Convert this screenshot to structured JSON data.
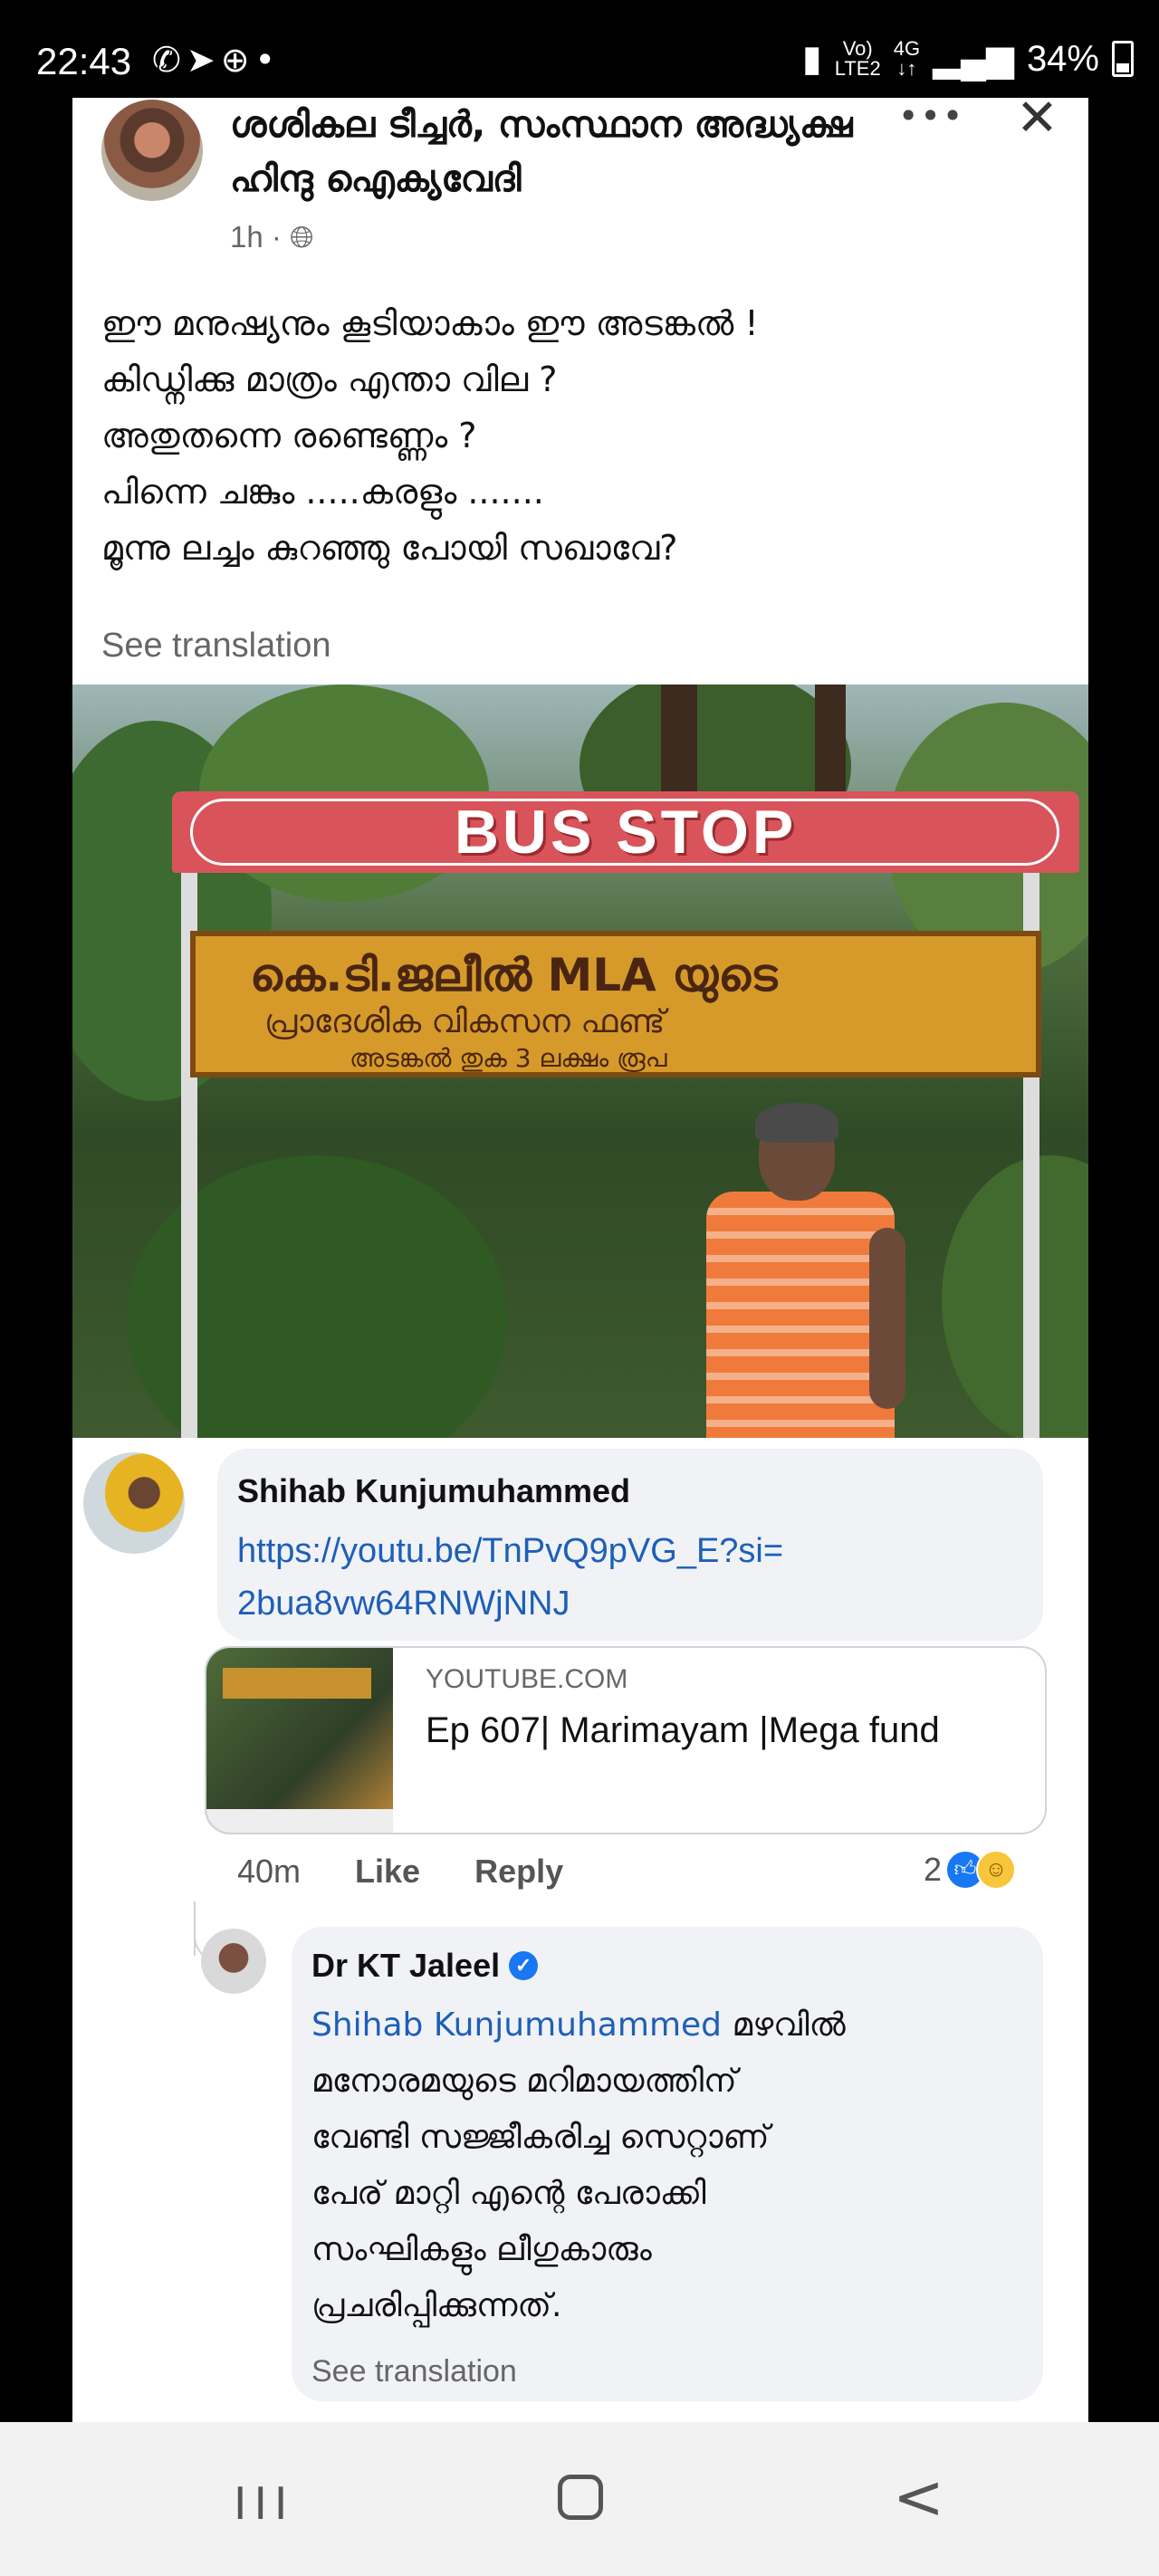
{
  "status_bar": {
    "time": "22:43",
    "left_icons": [
      "whatsapp-icon",
      "send-icon",
      "game-icon",
      "dot-icon"
    ],
    "carrier_line1": "Vo)",
    "carrier_line2": "LTE2",
    "net_line1": "4G",
    "net_line2": "↓↑",
    "battery": "34%"
  },
  "post": {
    "author": "ശശികല ടീച്ചർ, സംസ്ഥാന അദ്ധ്യക്ഷ ഹിന്ദു ഐക്യവേദി",
    "time": "1h",
    "audience_icon": "globe-icon",
    "text_lines": [
      "ഈ മനുഷ്യനും കൂടിയാകാം ഈ  അടങ്കൽ !",
      "കിഡ്നിക്കു മാത്രം എന്താ വില ?",
      "അതുതന്നെ രണ്ടെണ്ണം ?",
      "പിന്നെ ചങ്കും .....കരളും .......",
      "മൂന്നു ലച്ചം കുറഞ്ഞു പോയി സഖാവേ?"
    ],
    "see_translation": "See translation",
    "image": {
      "roof_sign": "BUS STOP",
      "board_line1": "കെ.ടി.ജലീൽ MLA യുടെ",
      "board_line2": "പ്രാദേശിക വികസന ഫണ്ട്",
      "board_line3": "അടങ്കൽ തുക 3 ലക്ഷം രൂപ"
    }
  },
  "comment": {
    "name": "Shihab Kunjumuhammed",
    "link_line1": "https://youtu.be/TnPvQ9pVG_E?si=",
    "link_line2": "2bua8vw64RNWjNNJ",
    "card_source": "YOUTUBE.COM",
    "card_title": "Ep 607| Marimayam |Mega fund",
    "age": "40m",
    "like_label": "Like",
    "reply_label": "Reply",
    "reaction_count": "2"
  },
  "reply": {
    "name": "Dr KT Jaleel",
    "mention": "Shihab Kunjumuhammed",
    "line1_rest": " മഴവിൽ",
    "text_lines": [
      "മനോരമയുടെ മറിമായത്തിന്",
      "വേണ്ടി സജ്ജീകരിച്ച സെറ്റാണ്",
      "പേര് മാറ്റി എന്റെ പേരാക്കി",
      "സംഘികളും ലീഗുകാരും",
      "പ്രചരിപ്പിക്കുന്നത്."
    ],
    "see_translation": "See translation"
  },
  "nav": {
    "recent": "III",
    "back": "<"
  }
}
